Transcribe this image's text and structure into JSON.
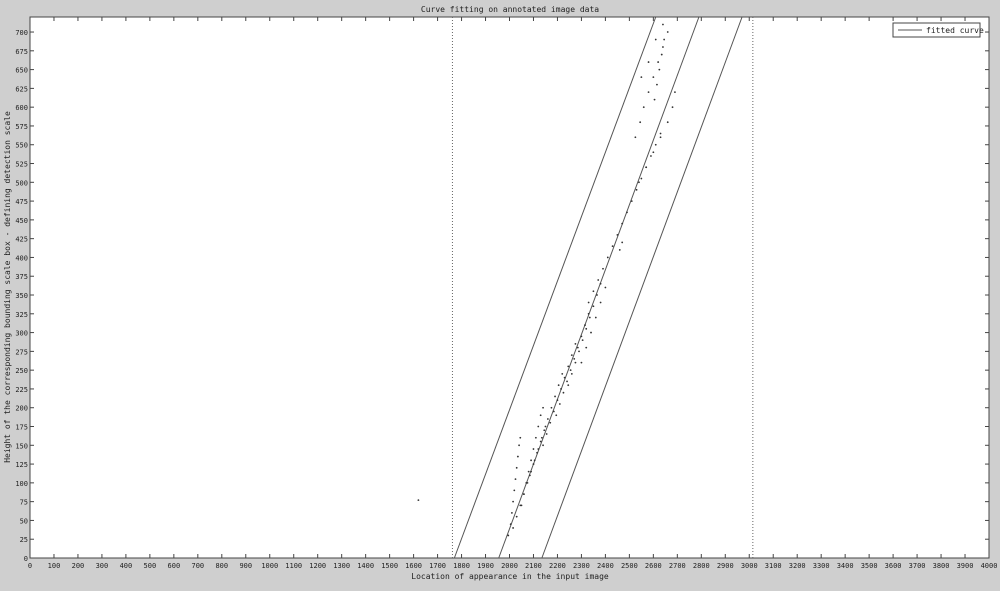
{
  "chart_data": {
    "type": "scatter",
    "title": "Curve fitting on annotated image data",
    "xlabel": "Location of appearance in the input image",
    "ylabel": "Height of the corresponding bounding scale box - defining detection scale",
    "xlim": [
      0,
      4000
    ],
    "ylim": [
      0,
      720
    ],
    "xticks": [
      0,
      100,
      200,
      300,
      400,
      500,
      600,
      700,
      800,
      900,
      1000,
      1100,
      1200,
      1300,
      1400,
      1500,
      1600,
      1700,
      1800,
      1900,
      2000,
      2100,
      2200,
      2300,
      2400,
      2500,
      2600,
      2700,
      2800,
      2900,
      3000,
      3100,
      3200,
      3300,
      3400,
      3500,
      3600,
      3700,
      3800,
      3900,
      4000
    ],
    "yticks": [
      0,
      25,
      50,
      75,
      100,
      125,
      150,
      175,
      200,
      225,
      250,
      275,
      300,
      325,
      350,
      375,
      400,
      425,
      450,
      475,
      500,
      525,
      550,
      575,
      600,
      625,
      650,
      675,
      700
    ],
    "grid": false,
    "legend": {
      "position": "top-right",
      "entries": [
        "fitted curve"
      ]
    },
    "colors": {
      "background": "#cfcfcf",
      "plot": "#ffffff",
      "points": "#333333",
      "line": "#555555"
    },
    "series": [
      {
        "name": "fitted curve",
        "kind": "line",
        "x": [
          1955,
          2790
        ],
        "y": [
          0,
          720
        ]
      },
      {
        "kind": "line",
        "x": [
          1770,
          2610
        ],
        "y": [
          0,
          720
        ]
      },
      {
        "kind": "line",
        "x": [
          2135,
          2970
        ],
        "y": [
          0,
          720
        ]
      },
      {
        "kind": "vline",
        "x": 1762
      },
      {
        "kind": "vline",
        "x": 3015
      },
      {
        "kind": "points",
        "x": [
          1995,
          2005,
          2010,
          2015,
          2020,
          2025,
          2030,
          2035,
          2040,
          2045,
          2050,
          2060,
          2070,
          2080,
          2090,
          2100,
          2110,
          2120,
          2130,
          2140,
          2015,
          2030,
          2045,
          2060,
          2075,
          2090,
          2105,
          2120,
          2135,
          2150,
          2085,
          2100,
          2115,
          2130,
          2145,
          2160,
          2175,
          2190,
          2205,
          2220,
          2140,
          2155,
          2170,
          2185,
          2200,
          2215,
          2230,
          2245,
          2260,
          2275,
          2195,
          2210,
          2225,
          2240,
          2255,
          2270,
          2285,
          2300,
          2315,
          2330,
          2245,
          2260,
          2275,
          2290,
          2305,
          2320,
          2335,
          2350,
          2365,
          2380,
          2300,
          2320,
          2340,
          2360,
          2380,
          2400,
          2330,
          2350,
          2370,
          2390,
          2410,
          2430,
          2450,
          2470,
          2490,
          2510,
          2530,
          2550,
          2570,
          2590,
          2610,
          2630,
          2525,
          2545,
          2560,
          2580,
          2600,
          2620,
          2640,
          2660,
          2550,
          2580,
          2610,
          2640,
          2540,
          2570,
          2600,
          2630,
          2660,
          2680,
          2690,
          2605,
          2615,
          2625,
          2635,
          2645,
          2460,
          2470,
          1620
        ],
        "y": [
          30,
          45,
          60,
          75,
          90,
          105,
          120,
          135,
          150,
          160,
          70,
          85,
          100,
          115,
          130,
          145,
          160,
          175,
          190,
          200,
          40,
          55,
          70,
          85,
          100,
          115,
          130,
          145,
          160,
          175,
          110,
          125,
          140,
          155,
          170,
          185,
          200,
          215,
          230,
          245,
          150,
          165,
          180,
          195,
          210,
          225,
          240,
          255,
          270,
          285,
          190,
          205,
          220,
          235,
          250,
          265,
          280,
          295,
          310,
          325,
          230,
          245,
          260,
          275,
          290,
          305,
          320,
          335,
          350,
          365,
          260,
          280,
          300,
          320,
          340,
          360,
          340,
          355,
          370,
          385,
          400,
          415,
          430,
          445,
          460,
          475,
          490,
          505,
          520,
          535,
          550,
          565,
          560,
          580,
          600,
          620,
          640,
          660,
          680,
          700,
          640,
          660,
          690,
          710,
          500,
          520,
          540,
          560,
          580,
          600,
          620,
          610,
          630,
          650,
          670,
          690,
          410,
          420,
          77
        ]
      }
    ]
  }
}
